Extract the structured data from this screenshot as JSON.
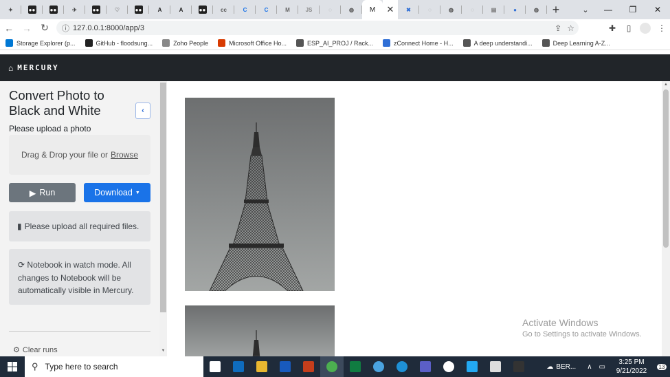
{
  "browser": {
    "tabs": [
      {
        "icon": "star-sparkle-icon",
        "color": "#444"
      },
      {
        "icon": "dots-icon",
        "color": "#222"
      },
      {
        "icon": "dots-icon",
        "color": "#222"
      },
      {
        "icon": "bird-icon",
        "color": "#444"
      },
      {
        "icon": "dots-icon",
        "color": "#222"
      },
      {
        "icon": "heart-icon",
        "color": "#888"
      },
      {
        "icon": "dots-icon",
        "color": "#222"
      },
      {
        "icon": "a-logo-icon",
        "color": "#222"
      },
      {
        "icon": "a-logo-icon",
        "color": "#222"
      },
      {
        "icon": "dots-icon",
        "color": "#222"
      },
      {
        "icon": "cc-icon",
        "color": "#555"
      },
      {
        "icon": "c-logo-icon",
        "color": "#1a73e8"
      },
      {
        "icon": "c-logo-icon",
        "color": "#1a73e8"
      },
      {
        "icon": "gmail-icon",
        "color": "#666"
      },
      {
        "icon": "js-icon",
        "color": "#888"
      },
      {
        "icon": "loading-icon",
        "color": "#999"
      },
      {
        "icon": "globe-icon",
        "color": "#555"
      }
    ],
    "active_tab": {
      "label": "M"
    },
    "tabs_after": [
      {
        "icon": "x-logo-icon",
        "color": "#2f6fd6"
      },
      {
        "icon": "loading-icon",
        "color": "#999"
      },
      {
        "icon": "globe-icon",
        "color": "#555"
      },
      {
        "icon": "loading-icon",
        "color": "#999"
      },
      {
        "icon": "doc-icon",
        "color": "#777"
      },
      {
        "icon": "circle-logo-icon",
        "color": "#2f6fd6"
      },
      {
        "icon": "globe-icon",
        "color": "#555"
      }
    ],
    "url": "127.0.0.1:8000/app/3",
    "bookmarks": [
      {
        "label": "Storage Explorer (p...",
        "icon": "azure-icon",
        "color": "#0078d4"
      },
      {
        "label": "GitHub - floodsung...",
        "icon": "github-icon",
        "color": "#222"
      },
      {
        "label": "Zoho People",
        "icon": "zoho-icon",
        "color": "#888"
      },
      {
        "label": "Microsoft Office Ho...",
        "icon": "office-icon",
        "color": "#d83b01"
      },
      {
        "label": "ESP_AI_PROJ / Rack...",
        "icon": "link-icon",
        "color": "#555"
      },
      {
        "label": "zConnect Home - H...",
        "icon": "zconnect-icon",
        "color": "#2f6fd6"
      },
      {
        "label": "A deep understandi...",
        "icon": "globe-icon",
        "color": "#555"
      },
      {
        "label": "Deep Learning A-Z...",
        "icon": "globe-icon",
        "color": "#555"
      }
    ]
  },
  "app": {
    "brand": "MERCURY"
  },
  "sidebar": {
    "title": "Convert Photo to Black and White",
    "upload_label": "Please upload a photo",
    "dropzone_text": "Drag & Drop your file or",
    "dropzone_link": "Browse",
    "run_label": "Run",
    "download_label": "Download",
    "alert_files": "Please upload all required files.",
    "alert_watch": "Notebook in watch mode. All changes to Notebook will be automatically visible in Mercury.",
    "clear_runs": "Clear runs"
  },
  "watermark": {
    "title": "Activate Windows",
    "subtitle": "Go to Settings to activate Windows."
  },
  "taskbar": {
    "search_placeholder": "Type here to search",
    "apps": [
      {
        "icon": "task-view-icon",
        "color": "#fff"
      },
      {
        "icon": "outlook-icon",
        "color": "#0f6cbd"
      },
      {
        "icon": "file-explorer-icon",
        "color": "#e8b730"
      },
      {
        "icon": "word-icon",
        "color": "#185abd"
      },
      {
        "icon": "powerpoint-icon",
        "color": "#c43e1c"
      },
      {
        "icon": "chrome-icon",
        "color": "#4caf50"
      },
      {
        "icon": "excel-icon",
        "color": "#107c41"
      },
      {
        "icon": "network-icon",
        "color": "#4aa3df"
      },
      {
        "icon": "edge-icon",
        "color": "#1e90d6"
      },
      {
        "icon": "teams-icon",
        "color": "#5b5fc7"
      },
      {
        "icon": "github-desktop-icon",
        "color": "#fff"
      },
      {
        "icon": "vscode-icon",
        "color": "#23a9f2"
      },
      {
        "icon": "notes-icon",
        "color": "#ddd"
      },
      {
        "icon": "terminal-icon",
        "color": "#333"
      }
    ],
    "weather": "BER...",
    "time": "3:25 PM",
    "date": "9/21/2022",
    "notifications": "13"
  }
}
